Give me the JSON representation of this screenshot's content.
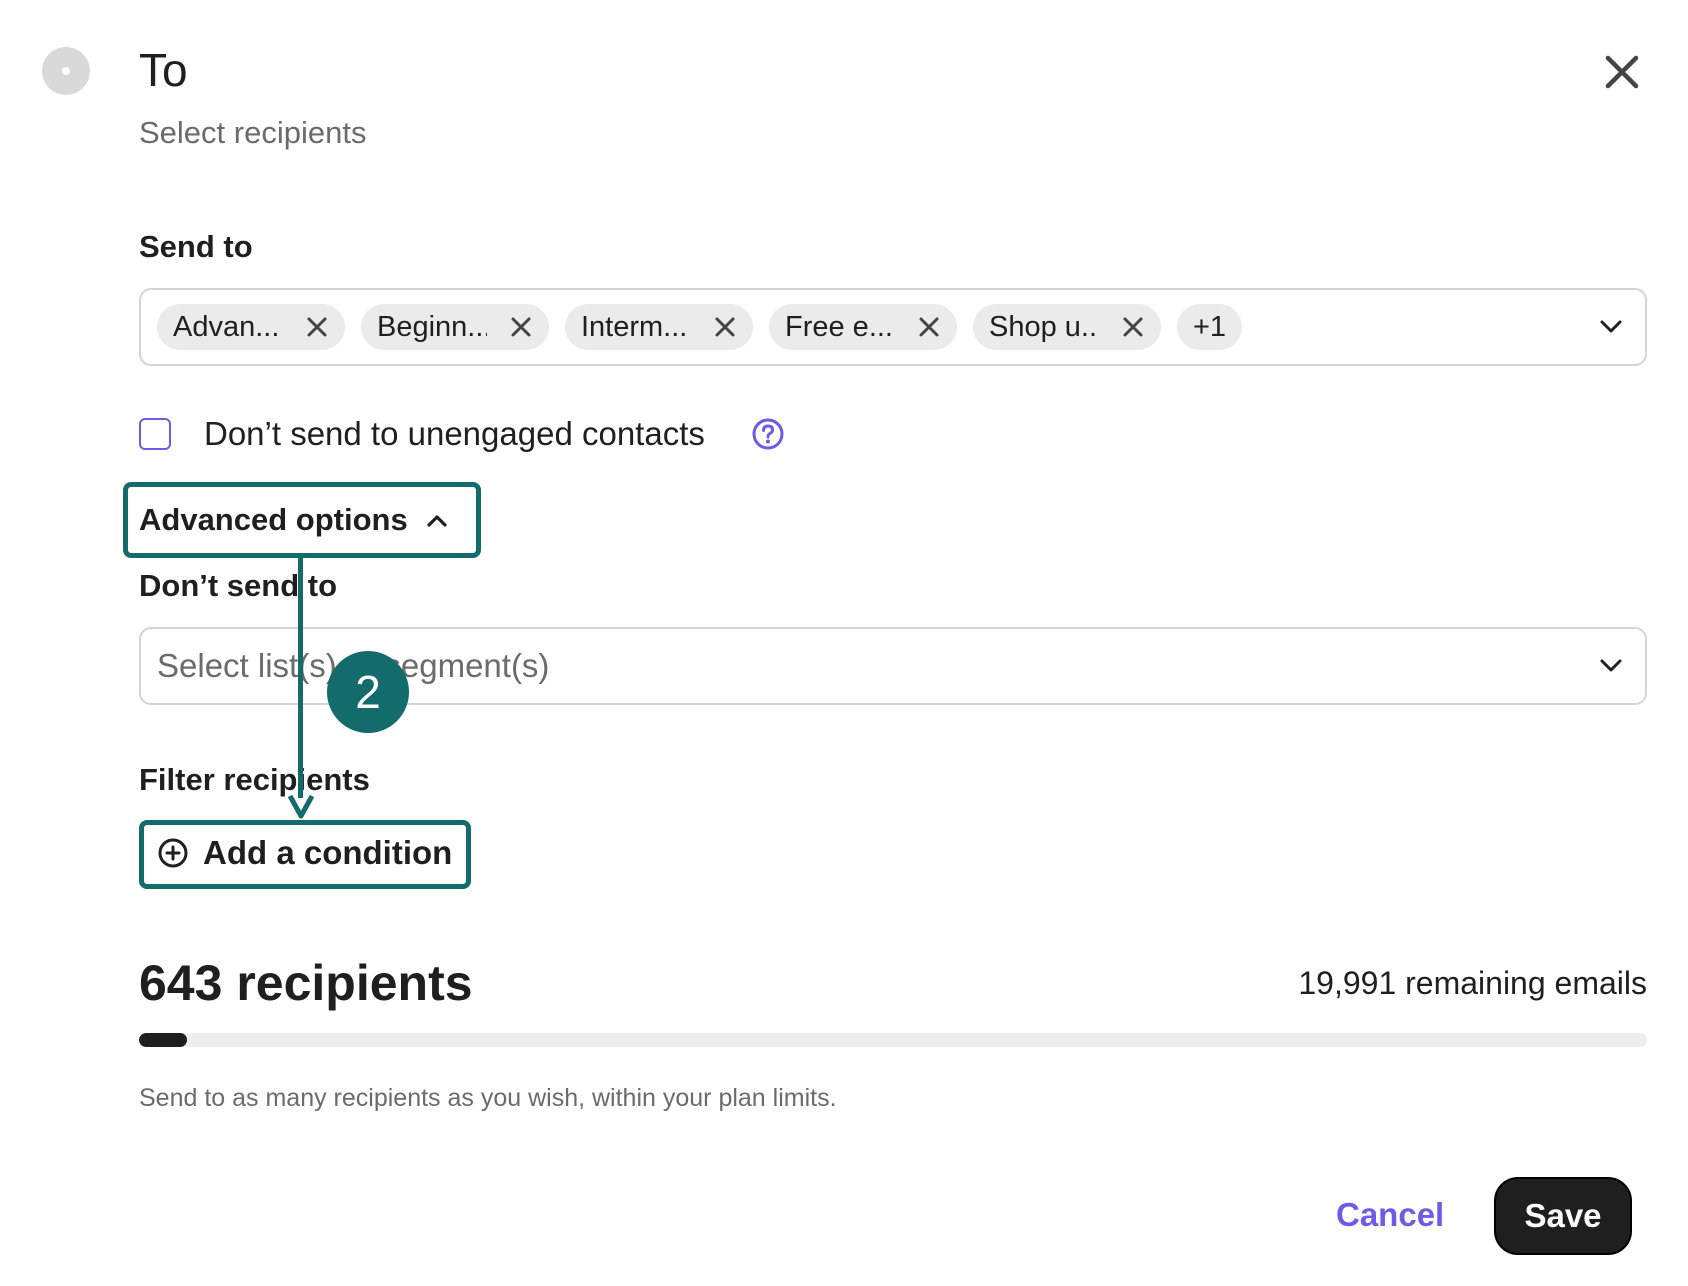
{
  "header": {
    "title": "To",
    "subtitle": "Select recipients"
  },
  "send_to": {
    "label": "Send to",
    "chips": [
      "Advan...",
      "Beginn...",
      "Interm...",
      "Free e...",
      "Shop u..."
    ],
    "more": "+1"
  },
  "unengaged": {
    "label": "Don’t send to unengaged contacts",
    "checked": false
  },
  "advanced": {
    "toggle_label": "Advanced options",
    "dont_send_label": "Don’t send to",
    "dont_send_placeholder": "Select list(s) or segment(s)",
    "filter_label": "Filter recipients",
    "add_condition_label": "Add a condition"
  },
  "annotation": {
    "step_number": "2",
    "color": "#136b6b"
  },
  "summary": {
    "recipients": "643 recipients",
    "remaining": "19,991 remaining emails",
    "usage_fraction": 0.032,
    "hint": "Send to as many recipients as you wish, within your plan limits."
  },
  "footer": {
    "cancel_label": "Cancel",
    "save_label": "Save"
  },
  "colors": {
    "accent": "#6c5ce7",
    "annotation": "#136b6b",
    "primary_button": "#1f1f1f"
  }
}
